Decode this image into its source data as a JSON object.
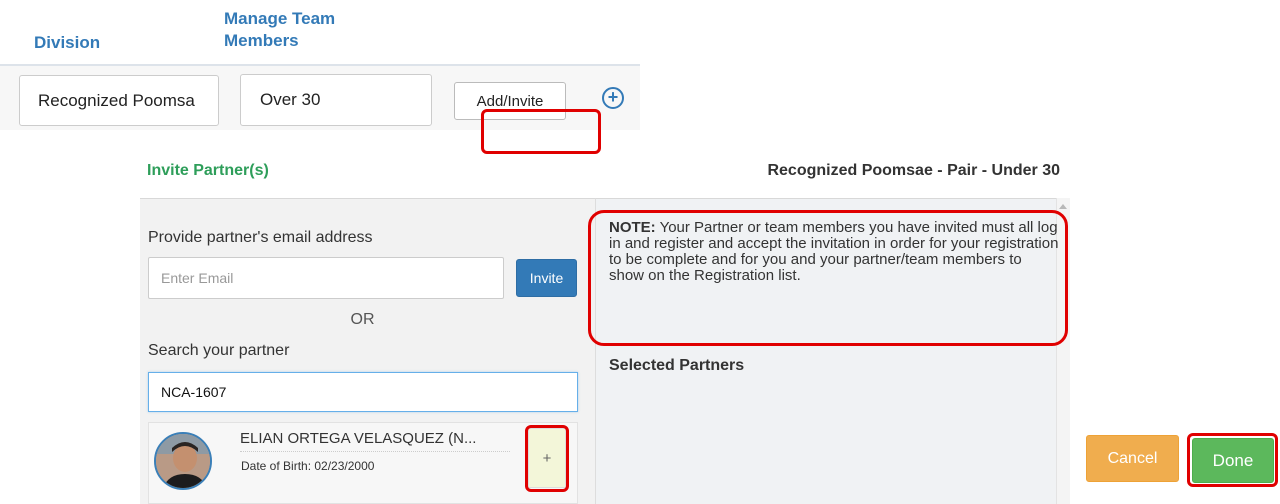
{
  "table": {
    "headers": {
      "division": "Division",
      "manage_team_members": "Manage Team Members"
    },
    "row": {
      "division_value": "Recognized Poomsa",
      "manage_value": "Over 30",
      "add_invite_label": "Add/Invite",
      "expand_icon": "circle-plus-icon"
    }
  },
  "modal": {
    "title": "Invite Partner(s)",
    "division_title": "Recognized Poomsae - Pair - Under 30",
    "email_section": {
      "label": "Provide partner's email address",
      "placeholder": "Enter Email",
      "invite_label": "Invite"
    },
    "or_label": "OR",
    "search_section": {
      "label": "Search your partner",
      "value": "NCA-1607"
    },
    "search_results": [
      {
        "name": "ELIAN ORTEGA VELASQUEZ (N...",
        "dob_label": "Date of Birth: 02/23/2000",
        "add_label": "+"
      }
    ],
    "note": {
      "prefix": "NOTE:",
      "text": " Your Partner or team members you have invited must all log in and register and accept the invitation in order for your registration to be complete and for you and your partner/team members to show on the Registration list."
    },
    "selected_partners_label": "Selected Partners",
    "cancel_label": "Cancel",
    "done_label": "Done"
  },
  "colors": {
    "header_blue": "#337ab7",
    "title_green": "#2e9e5a",
    "invite_blue": "#337ab7",
    "cancel_orange": "#f0ad4e",
    "done_green": "#5cb85c",
    "highlight_red": "#e00000"
  }
}
